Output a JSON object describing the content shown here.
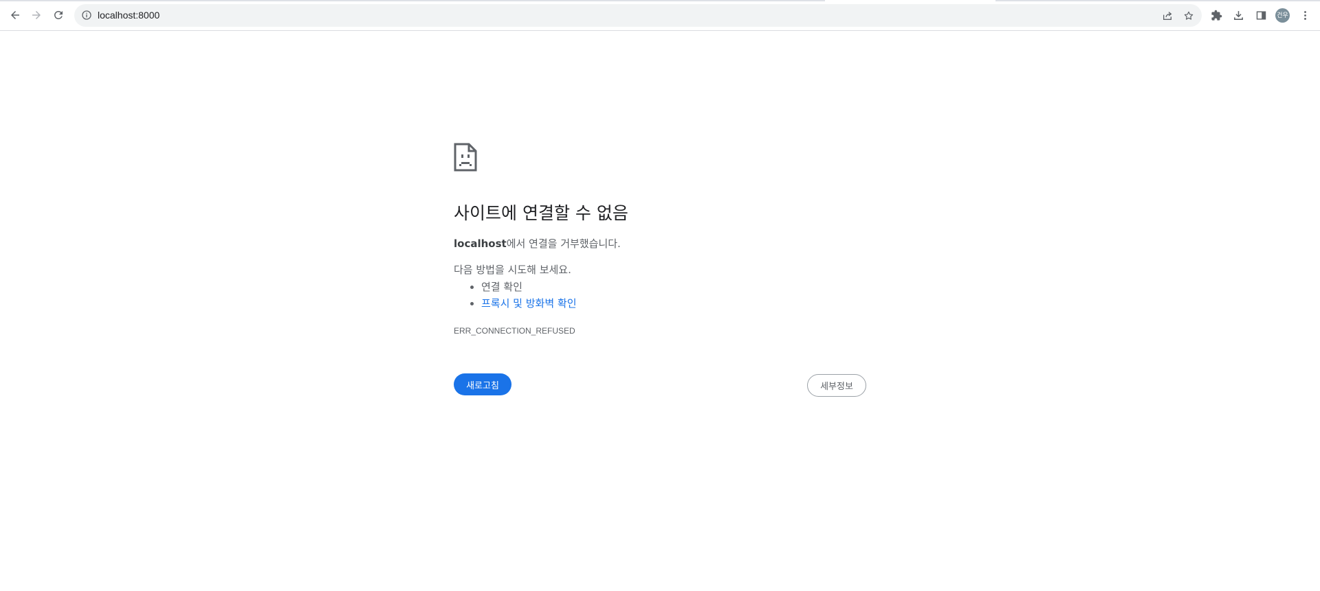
{
  "browser": {
    "url": "localhost:8000",
    "profile_initials": "건우",
    "icons": {
      "back": "back-arrow-icon",
      "forward": "forward-arrow-icon",
      "reload": "reload-icon",
      "site_info": "info-icon",
      "share": "share-icon",
      "bookmark": "star-icon",
      "extensions": "puzzle-icon",
      "downloads": "download-icon",
      "side_panel": "side-panel-icon",
      "menu": "more-vertical-icon"
    }
  },
  "error_page": {
    "icon": "sad-document-icon",
    "title": "사이트에 연결할 수 없음",
    "host": "localhost",
    "refused_text": "에서 연결을 거부했습니다.",
    "suggestions_heading": "다음 방법을 시도해 보세요.",
    "suggestions": [
      {
        "text": "연결 확인",
        "link": false
      },
      {
        "text": "프록시 및 방화벽 확인",
        "link": true
      }
    ],
    "error_code": "ERR_CONNECTION_REFUSED",
    "reload_label": "새로고침",
    "details_label": "세부정보"
  },
  "colors": {
    "accent": "#1a73e8",
    "text_primary": "#202124",
    "text_secondary": "#5f6368",
    "omnibox_bg": "#f1f3f4"
  }
}
